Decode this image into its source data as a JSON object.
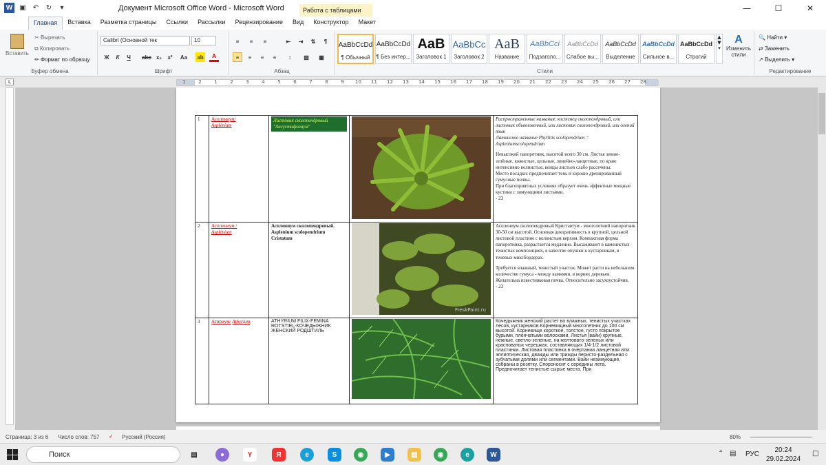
{
  "titlebar": {
    "title": "Документ Microsoft Office Word  -  Microsoft Word",
    "context_tab": "Работа с таблицами"
  },
  "tabs": [
    "Главная",
    "Вставка",
    "Разметка страницы",
    "Ссылки",
    "Рассылки",
    "Рецензирование",
    "Вид",
    "Конструктор",
    "Макет"
  ],
  "clipboard": {
    "paste": "Вставить",
    "cut": "Вырезать",
    "copy": "Копировать",
    "format_painter": "Формат по образцу",
    "label": "Буфер обмена"
  },
  "font": {
    "name": "Calibri (Основной тек",
    "size": "10",
    "label": "Шрифт",
    "bold": "Ж",
    "italic": "К",
    "underline": "Ч",
    "strike": "abc",
    "sub": "x₂",
    "sup": "x²",
    "case": "Aa"
  },
  "paragraph": {
    "label": "Абзац"
  },
  "styles": {
    "label": "Стили",
    "items": [
      {
        "preview": "AaBbCcDd",
        "name": "¶ Обычный"
      },
      {
        "preview": "AaBbCcDd",
        "name": "¶ Без интер..."
      },
      {
        "preview": "AaB",
        "name": "Заголовок 1"
      },
      {
        "preview": "AaBbCc",
        "name": "Заголовок 2"
      },
      {
        "preview": "AaB",
        "name": "Название"
      },
      {
        "preview": "AaBbCci",
        "name": "Подзаголо..."
      },
      {
        "preview": "AaBbCcDd",
        "name": "Слабое вы..."
      },
      {
        "preview": "AaBbCcDd",
        "name": "Выделение"
      },
      {
        "preview": "AaBbCcDd",
        "name": "Сильное в..."
      },
      {
        "preview": "AaBbCcDd",
        "name": "Строгий"
      }
    ],
    "change": "Изменить стили"
  },
  "editing": {
    "label": "Редактирование",
    "find": "Найти",
    "replace": "Заменить",
    "select": "Выделить"
  },
  "ruler_numbers": [
    "1",
    "2",
    "1",
    "2",
    "3",
    "4",
    "5",
    "6",
    "7",
    "8",
    "9",
    "10",
    "11",
    "12",
    "13",
    "14",
    "15",
    "16",
    "17",
    "18",
    "19",
    "20",
    "21",
    "22",
    "23",
    "24",
    "25",
    "26",
    "27",
    "28"
  ],
  "table": [
    {
      "n": "1",
      "genus_ru": "Асплениум/",
      "genus_lat": "Asplénium",
      "variety": "Листовик сколопендровый \"Ансустифолиум\"",
      "desc": [
        "Распространенные названия: костенец сколопендровый, или листовик обыкновенный, или листовик сколопендровый, или олений язык",
        "Латинское название Phyllitis scolopendrium = Aspleniumscolopendrium",
        "Невысокий папоротник, высотой всего 30 см. Листья зимне-зелёные, кожистые, цельные, линейно-ланцетные, по краю интенсивно волнистые, концы листьев слабо рассечены.",
        "Место посадки: предпочитает тень и хорошо дренированный гумусные почвы.",
        "При благоприятных условиях образует очень эффектные мощные кустики с зимующими листьями.",
        "- 23"
      ]
    },
    {
      "n": "2",
      "genus_ru": "Асплениум /",
      "genus_lat": "Asplénium",
      "variety": "Асплениум сколопендровый. Asplenium scolopendrium Cristatum",
      "desc": [
        "Асплениум сколопендровый Криставтум - многолетний папоротник 30-50 см высотой. Основная декоративность в крупной, цельной листовой пластине с волнистым верхом. Компактная форма папоротника, разрастается медленно. Высаживают в каменистых тенистых композициях, в качестве опушки к кустарникам, в теневых миксбордерах.",
        "Требуется влажный, тенистый участок. Может расти на небольшом количестве гумуса - между камнями, в корнях деревьев. Желательна известняковая почва. Относительно засухоустойчив.",
        "- 23"
      ]
    },
    {
      "n": "3",
      "genus_ru": "Атириум/",
      "genus_lat": "Athyrium",
      "variety": "ATHYRIUM FILIX-FEMINA ROTSTIEL-КОЧЕДЫЖНИК ЖЕНСКИЙ РОДШТИЛЬ",
      "desc": [
        "Кочедыжник женский  растет во влажных, тенистых участках лесов, кустарников.Корневищный многолетник до 100 см высотой. Корневище короткое, толстое, густо покрытое бурыми, пленчатыми волосками. Листья (вайи)  крупные, нежные, светло-зеленые,  на желтовато-зеленых или красноватых черешках, составляющих 1/4-1/2 листовой пластинки. Листовая пластинка в очертании ланцетная  или эллиптическая, дважды или трижды перисто-раздельная с зубчатыми долями или сегментами.  Вайи незимующие, собраны в розетку. Спороносит с середины лета. Предпочитает тенистые  сырые места. При"
      ]
    }
  ],
  "watermark": "FreskPaint.ru",
  "status": {
    "page": "Страница: 3 из 6",
    "words": "Число слов: 757",
    "lang": "Русский (Россия)",
    "zoom": "80%"
  },
  "taskbar": {
    "search": "Поиск",
    "lang": "РУС",
    "time": "20:24",
    "date": "29.02.2024"
  }
}
